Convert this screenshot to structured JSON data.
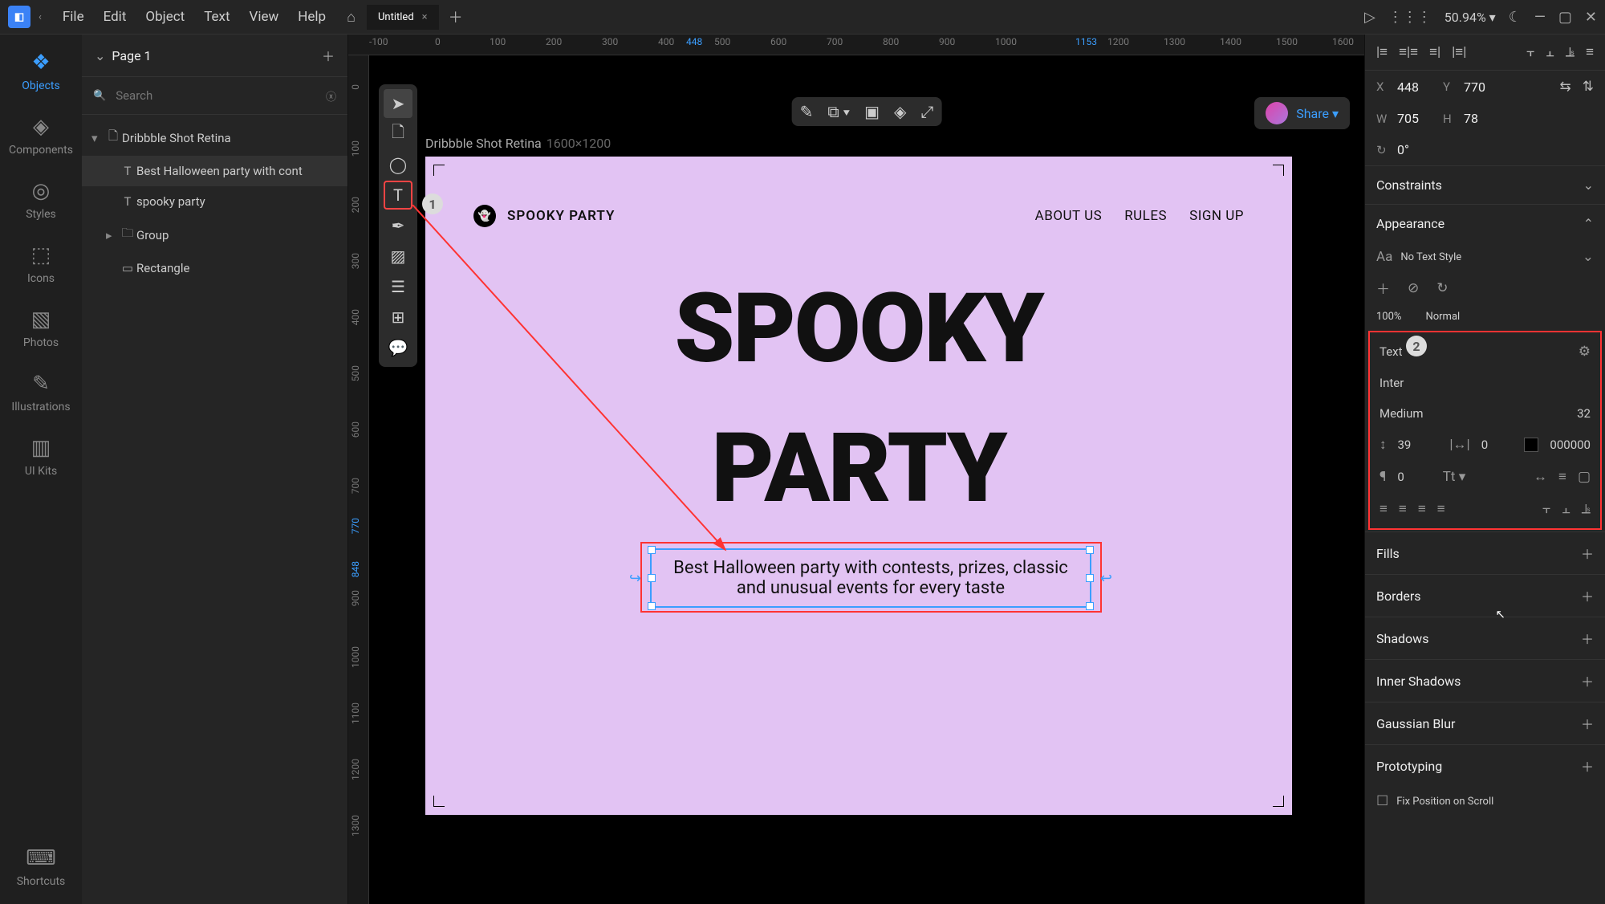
{
  "menu": {
    "items": [
      "File",
      "Edit",
      "Object",
      "Text",
      "View",
      "Help"
    ],
    "tab_title": "Untitled",
    "zoom": "50.94%"
  },
  "iconbar": {
    "items": [
      "Objects",
      "Components",
      "Styles",
      "Icons",
      "Photos",
      "Illustrations",
      "UI Kits"
    ],
    "bottom": "Shortcuts"
  },
  "layers": {
    "page": "Page 1",
    "search_placeholder": "Search",
    "tree": [
      {
        "label": "Dribbble Shot Retina",
        "depth": 0,
        "icon": "artboard",
        "expand": "▾"
      },
      {
        "label": "Best Halloween party with cont",
        "depth": 1,
        "icon": "T",
        "selected": true
      },
      {
        "label": "spooky party",
        "depth": 1,
        "icon": "T"
      },
      {
        "label": "Group",
        "depth": 1,
        "icon": "folder",
        "expand": "▸"
      },
      {
        "label": "Rectangle",
        "depth": 1,
        "icon": "rect"
      }
    ]
  },
  "ruler_h": [
    {
      "v": "-100",
      "p": 0
    },
    {
      "v": "0",
      "p": 82
    },
    {
      "v": "100",
      "p": 150
    },
    {
      "v": "200",
      "p": 220
    },
    {
      "v": "300",
      "p": 290
    },
    {
      "v": "400",
      "p": 360
    },
    {
      "v": "448",
      "p": 395,
      "hl": true
    },
    {
      "v": "500",
      "p": 430
    },
    {
      "v": "600",
      "p": 500
    },
    {
      "v": "700",
      "p": 570
    },
    {
      "v": "800",
      "p": 640
    },
    {
      "v": "900",
      "p": 710
    },
    {
      "v": "1000",
      "p": 780
    },
    {
      "v": "1153",
      "p": 880,
      "hl": true
    },
    {
      "v": "1200",
      "p": 920
    },
    {
      "v": "1300",
      "p": 990
    },
    {
      "v": "1400",
      "p": 1060
    },
    {
      "v": "1500",
      "p": 1130
    },
    {
      "v": "1600",
      "p": 1200
    }
  ],
  "ruler_v": [
    {
      "v": "0",
      "p": 36
    },
    {
      "v": "100",
      "p": 106
    },
    {
      "v": "200",
      "p": 176
    },
    {
      "v": "300",
      "p": 246
    },
    {
      "v": "400",
      "p": 316
    },
    {
      "v": "500",
      "p": 386
    },
    {
      "v": "600",
      "p": 456
    },
    {
      "v": "700",
      "p": 526
    },
    {
      "v": "770",
      "p": 576,
      "hl": true
    },
    {
      "v": "848",
      "p": 630,
      "hl": true
    },
    {
      "v": "900",
      "p": 666
    },
    {
      "v": "1000",
      "p": 736
    },
    {
      "v": "1100",
      "p": 806
    },
    {
      "v": "1200",
      "p": 876
    },
    {
      "v": "1300",
      "p": 946
    }
  ],
  "artboard": {
    "label": "Dribbble Shot Retina",
    "dim": "1600×1200",
    "brand": "SPOOKY PARTY",
    "nav": [
      "ABOUT US",
      "RULES",
      "SIGN UP"
    ],
    "headline1": "SPOOKY",
    "headline2": "PARTY",
    "subtext": "Best Halloween party with contests, prizes, classic and unusual events for every taste"
  },
  "share": "Share",
  "annotations": {
    "n1": "1",
    "n2": "2"
  },
  "props": {
    "x": "448",
    "y": "770",
    "w": "705",
    "h": "78",
    "rot": "0°",
    "constraints": "Constraints",
    "appearance": "Appearance",
    "textstyle": "No Text Style",
    "opacity": "100%",
    "blend": "Normal",
    "text_section": "Text",
    "font": "Inter",
    "weight": "Medium",
    "size": "32",
    "lineheight": "39",
    "letterspacing": "0",
    "colorhex": "000000",
    "paragraph": "0",
    "fills": "Fills",
    "borders": "Borders",
    "shadows": "Shadows",
    "inner_shadows": "Inner Shadows",
    "blur": "Gaussian Blur",
    "prototyping": "Prototyping",
    "fixpos": "Fix Position on Scroll"
  }
}
